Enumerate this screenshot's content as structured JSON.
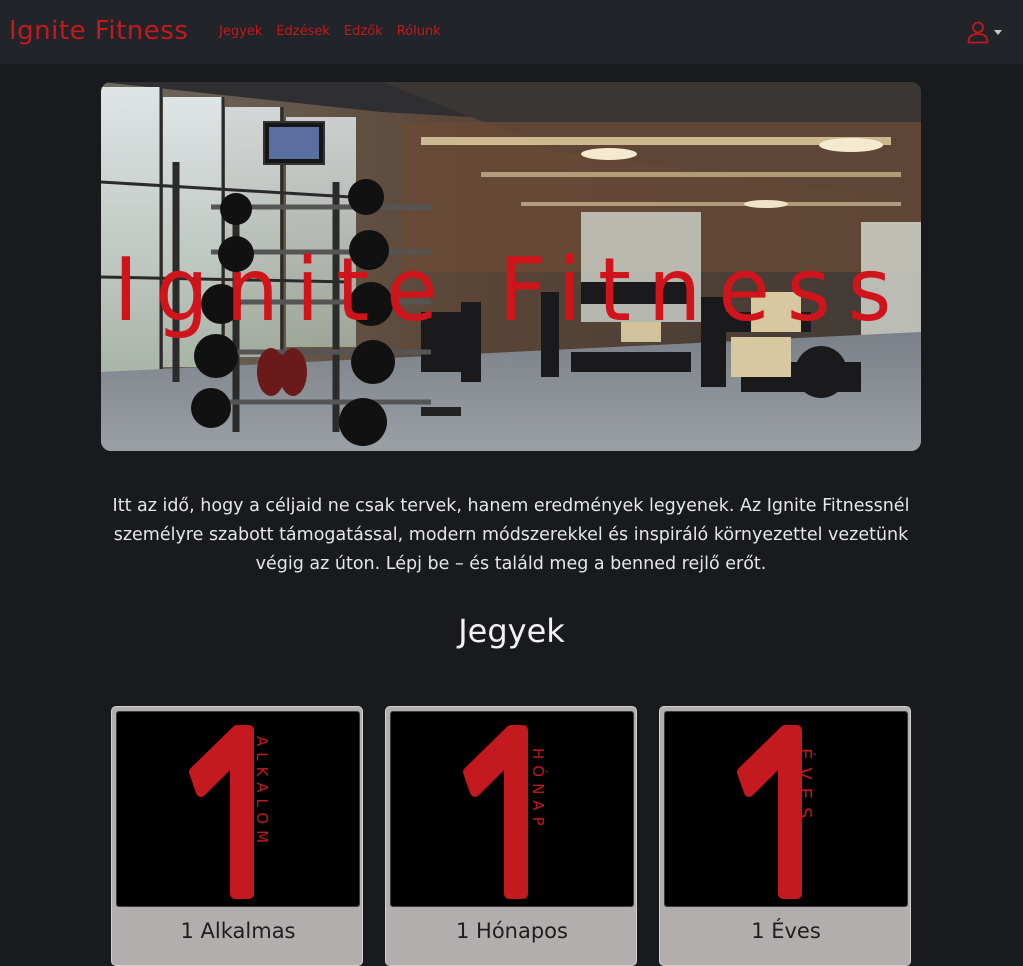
{
  "navbar": {
    "brand": "Ignite Fitness",
    "links": [
      "Jegyek",
      "Edzések",
      "Edzők",
      "Rólunk"
    ],
    "user_icon": "user-icon"
  },
  "hero": {
    "title": "Ignite Fitness"
  },
  "intro": {
    "text": "Itt az idő, hogy a céljaid ne csak tervek, hanem eredmények legyenek. Az Ignite Fitnessnél személyre szabott támogatással, modern módszerekkel és inspiráló környezettel vezetünk végig az úton. Lépj be – és találd meg a benned rejlő erőt."
  },
  "section": {
    "title": "Jegyek"
  },
  "cards": [
    {
      "number": "1",
      "word": "ALKALOM",
      "title": "1 Alkalmas"
    },
    {
      "number": "1",
      "word": "HÓNAP",
      "title": "1 Hónapos"
    },
    {
      "number": "1",
      "word": "ÉVES",
      "title": "1 Éves"
    }
  ],
  "colors": {
    "accent": "#c3191f",
    "background": "#181a1d",
    "navbar": "#212428",
    "card": "#b3aeae"
  }
}
